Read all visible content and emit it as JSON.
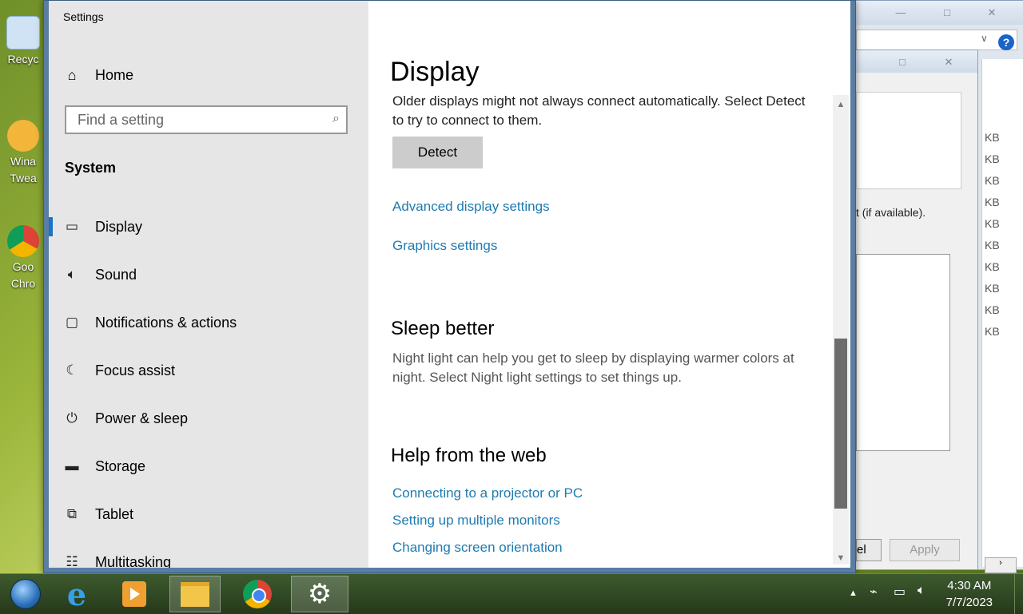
{
  "desktop": {
    "icons": [
      {
        "label": "Recyc",
        "icon": "recycle-bin-icon"
      },
      {
        "label": "Wina Twea",
        "icon": "winaero-tweaker-icon"
      },
      {
        "label": "Goo Chro",
        "icon": "google-chrome-icon"
      }
    ]
  },
  "background_window": {
    "text": "t (if available).",
    "sizes": [
      "KB",
      "KB",
      "KB",
      "KB",
      "KB",
      "KB",
      "KB",
      "KB",
      "KB",
      "KB"
    ],
    "apply_label": "Apply",
    "cancel_partial": "el"
  },
  "settings": {
    "app_title": "Settings",
    "home_label": "Home",
    "search_placeholder": "Find a setting",
    "section_label": "System",
    "nav": [
      {
        "label": "Display",
        "icon": "monitor-icon",
        "active": true
      },
      {
        "label": "Sound",
        "icon": "speaker-icon"
      },
      {
        "label": "Notifications & actions",
        "icon": "notification-icon"
      },
      {
        "label": "Focus assist",
        "icon": "moon-icon"
      },
      {
        "label": "Power & sleep",
        "icon": "power-icon"
      },
      {
        "label": "Storage",
        "icon": "storage-icon"
      },
      {
        "label": "Tablet",
        "icon": "tablet-icon"
      },
      {
        "label": "Multitasking",
        "icon": "multitasking-icon"
      }
    ],
    "page_title": "Display",
    "detect_text": "Older displays might not always connect automatically. Select Detect to try to connect to them.",
    "detect_line1": "Older displays might not always connect automatically. Select Detect",
    "detect_line2": "to try to connect to them.",
    "detect_button": "Detect",
    "link_advanced": "Advanced display settings",
    "link_graphics": "Graphics settings",
    "sleep_heading": "Sleep better",
    "sleep_line1": "Night light can help you get to sleep by displaying warmer colors at",
    "sleep_line2": "night. Select Night light settings to set things up.",
    "help_heading": "Help from the web",
    "help_links": [
      "Connecting to a projector or PC",
      "Setting up multiple monitors",
      "Changing screen orientation"
    ]
  },
  "taskbar": {
    "time": "4:30 AM",
    "date": "7/7/2023",
    "pinned": [
      {
        "icon": "start-orb-icon"
      },
      {
        "icon": "internet-explorer-icon"
      },
      {
        "icon": "media-player-icon"
      },
      {
        "icon": "file-explorer-icon"
      },
      {
        "icon": "chrome-icon"
      },
      {
        "icon": "settings-gear-icon"
      }
    ]
  },
  "colors": {
    "link": "#1e7bb0",
    "accent": "#1a73c8",
    "taskbar": "#2f4722"
  }
}
